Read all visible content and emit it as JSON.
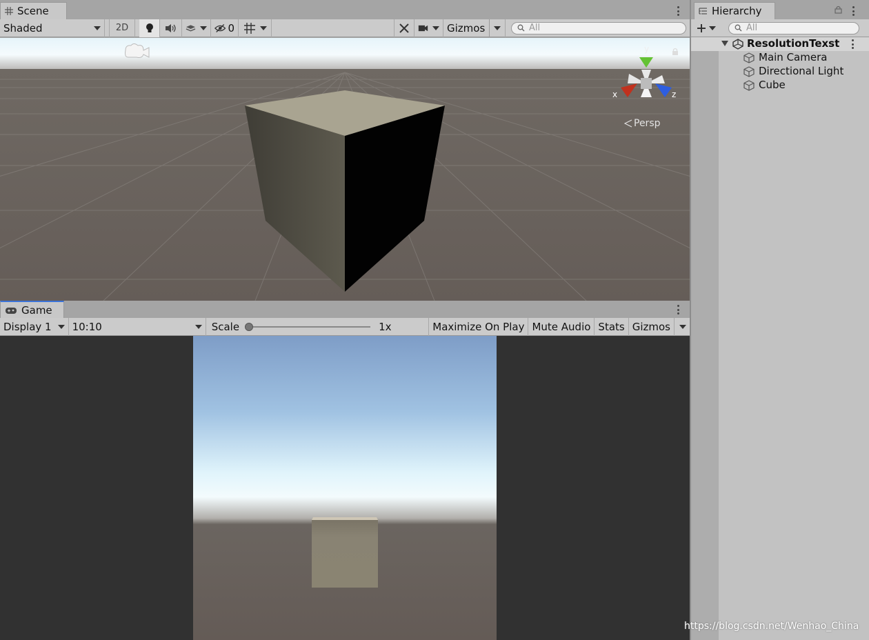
{
  "scene": {
    "tab_label": "Scene",
    "shading_mode": "Shaded",
    "btn_2d": "2D",
    "hidden_count": "0",
    "gizmos_label": "Gizmos",
    "search_placeholder": "All",
    "persp_label": "Persp",
    "axis_x": "x",
    "axis_y": "y",
    "axis_z": "z"
  },
  "game": {
    "tab_label": "Game",
    "display": "Display 1",
    "aspect": "10:10",
    "scale_label": "Scale",
    "scale_value": "1x",
    "maximize_label": "Maximize On Play",
    "mute_label": "Mute Audio",
    "stats_label": "Stats",
    "gizmos_label": "Gizmos"
  },
  "hierarchy": {
    "tab_label": "Hierarchy",
    "search_placeholder": "All",
    "scene_name": "ResolutionTexst",
    "items": [
      "Main Camera",
      "Directional Light",
      "Cube"
    ]
  },
  "watermark": "https://blog.csdn.net/Wenhao_China"
}
